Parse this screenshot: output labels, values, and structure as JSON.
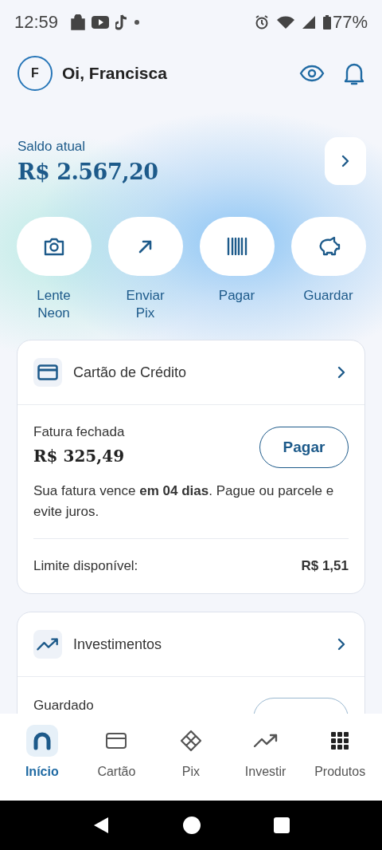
{
  "status_bar": {
    "time": "12:59",
    "battery": "77%"
  },
  "header": {
    "avatar": "F",
    "greeting": "Oi, Francisca"
  },
  "balance": {
    "label": "Saldo atual",
    "amount": "R$ 2.567,20"
  },
  "actions": [
    {
      "kind": "camera",
      "label": "Lente Neon"
    },
    {
      "kind": "send",
      "label": "Enviar Pix"
    },
    {
      "kind": "barcode",
      "label": "Pagar"
    },
    {
      "kind": "piggy",
      "label": "Guardar"
    }
  ],
  "credit_card": {
    "title": "Cartão de Crédito",
    "status": "Fatura fechada",
    "amount": "R$ 325,49",
    "pay_button": "Pagar",
    "message": "Sua fatura vence **em 04 dias**. Pague ou parcele e evite juros.",
    "limit_label": "Limite disponível:",
    "limit_value": "R$ 1,51"
  },
  "investments": {
    "title": "Investimentos",
    "row_label": "Guardado"
  },
  "bottom_nav": [
    {
      "kind": "home",
      "label": "Início",
      "selected": true
    },
    {
      "kind": "card",
      "label": "Cartão",
      "selected": false
    },
    {
      "kind": "pix",
      "label": "Pix",
      "selected": false
    },
    {
      "kind": "invest",
      "label": "Investir",
      "selected": false
    },
    {
      "kind": "grid",
      "label": "Produtos",
      "selected": false
    }
  ]
}
